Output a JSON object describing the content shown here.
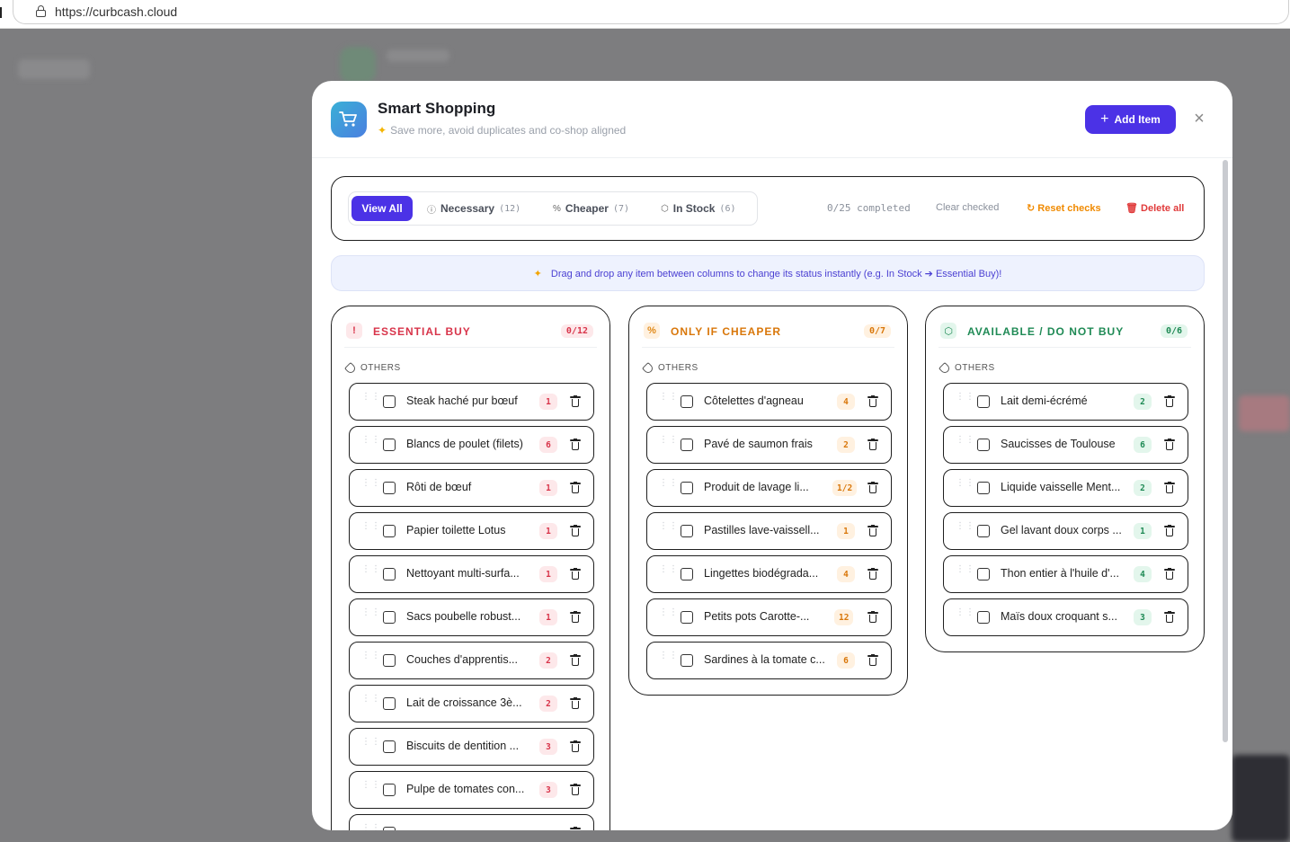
{
  "browser": {
    "url": "https://curbcash.cloud"
  },
  "modal": {
    "title": "Smart Shopping",
    "subtitle": "Save more, avoid duplicates and co-shop aligned",
    "add_item_label": "Add Item",
    "close_label": "×"
  },
  "filters": {
    "tabs": [
      {
        "label": "View All",
        "count": ""
      },
      {
        "label": "Necessary",
        "count": "(12)"
      },
      {
        "label": "Cheaper",
        "count": "(7)"
      },
      {
        "label": "In Stock",
        "count": "(6)"
      }
    ],
    "completed": "0/25 completed",
    "clear_checked": "Clear checked",
    "reset_checks": "Reset checks",
    "delete_all": "Delete all"
  },
  "hint": "Drag and drop any item between columns to change its status instantly (e.g. In Stock ➔ Essential Buy)!",
  "columns": [
    {
      "title": "ESSENTIAL BUY",
      "count": "0/12",
      "group": "OTHERS",
      "items": [
        {
          "name": "Steak haché pur bœuf",
          "qty": "1"
        },
        {
          "name": "Blancs de poulet (filets)",
          "qty": "6"
        },
        {
          "name": "Rôti de bœuf",
          "qty": "1"
        },
        {
          "name": "Papier toilette Lotus",
          "qty": "1"
        },
        {
          "name": "Nettoyant multi-surfa...",
          "qty": "1"
        },
        {
          "name": "Sacs poubelle robust...",
          "qty": "1"
        },
        {
          "name": "Couches d'apprentis...",
          "qty": "2"
        },
        {
          "name": "Lait de croissance 3è...",
          "qty": "2"
        },
        {
          "name": "Biscuits de dentition ...",
          "qty": "3"
        },
        {
          "name": "Pulpe de tomates con...",
          "qty": "3"
        }
      ]
    },
    {
      "title": "ONLY IF CHEAPER",
      "count": "0/7",
      "group": "OTHERS",
      "items": [
        {
          "name": "Côtelettes d'agneau",
          "qty": "4"
        },
        {
          "name": "Pavé de saumon frais",
          "qty": "2"
        },
        {
          "name": "Produit de lavage li...",
          "qty": "1/2"
        },
        {
          "name": "Pastilles lave-vaissell...",
          "qty": "1"
        },
        {
          "name": "Lingettes biodégrada...",
          "qty": "4"
        },
        {
          "name": "Petits pots Carotte-...",
          "qty": "12"
        },
        {
          "name": "Sardines à la tomate c...",
          "qty": "6"
        }
      ]
    },
    {
      "title": "AVAILABLE / DO NOT BUY",
      "count": "0/6",
      "group": "OTHERS",
      "items": [
        {
          "name": "Lait demi-écrémé",
          "qty": "2"
        },
        {
          "name": "Saucisses de Toulouse",
          "qty": "6"
        },
        {
          "name": "Liquide vaisselle Ment...",
          "qty": "2"
        },
        {
          "name": "Gel lavant doux corps ...",
          "qty": "1"
        },
        {
          "name": "Thon entier à l'huile d'...",
          "qty": "4"
        },
        {
          "name": "Maïs doux croquant s...",
          "qty": "3"
        }
      ]
    }
  ]
}
